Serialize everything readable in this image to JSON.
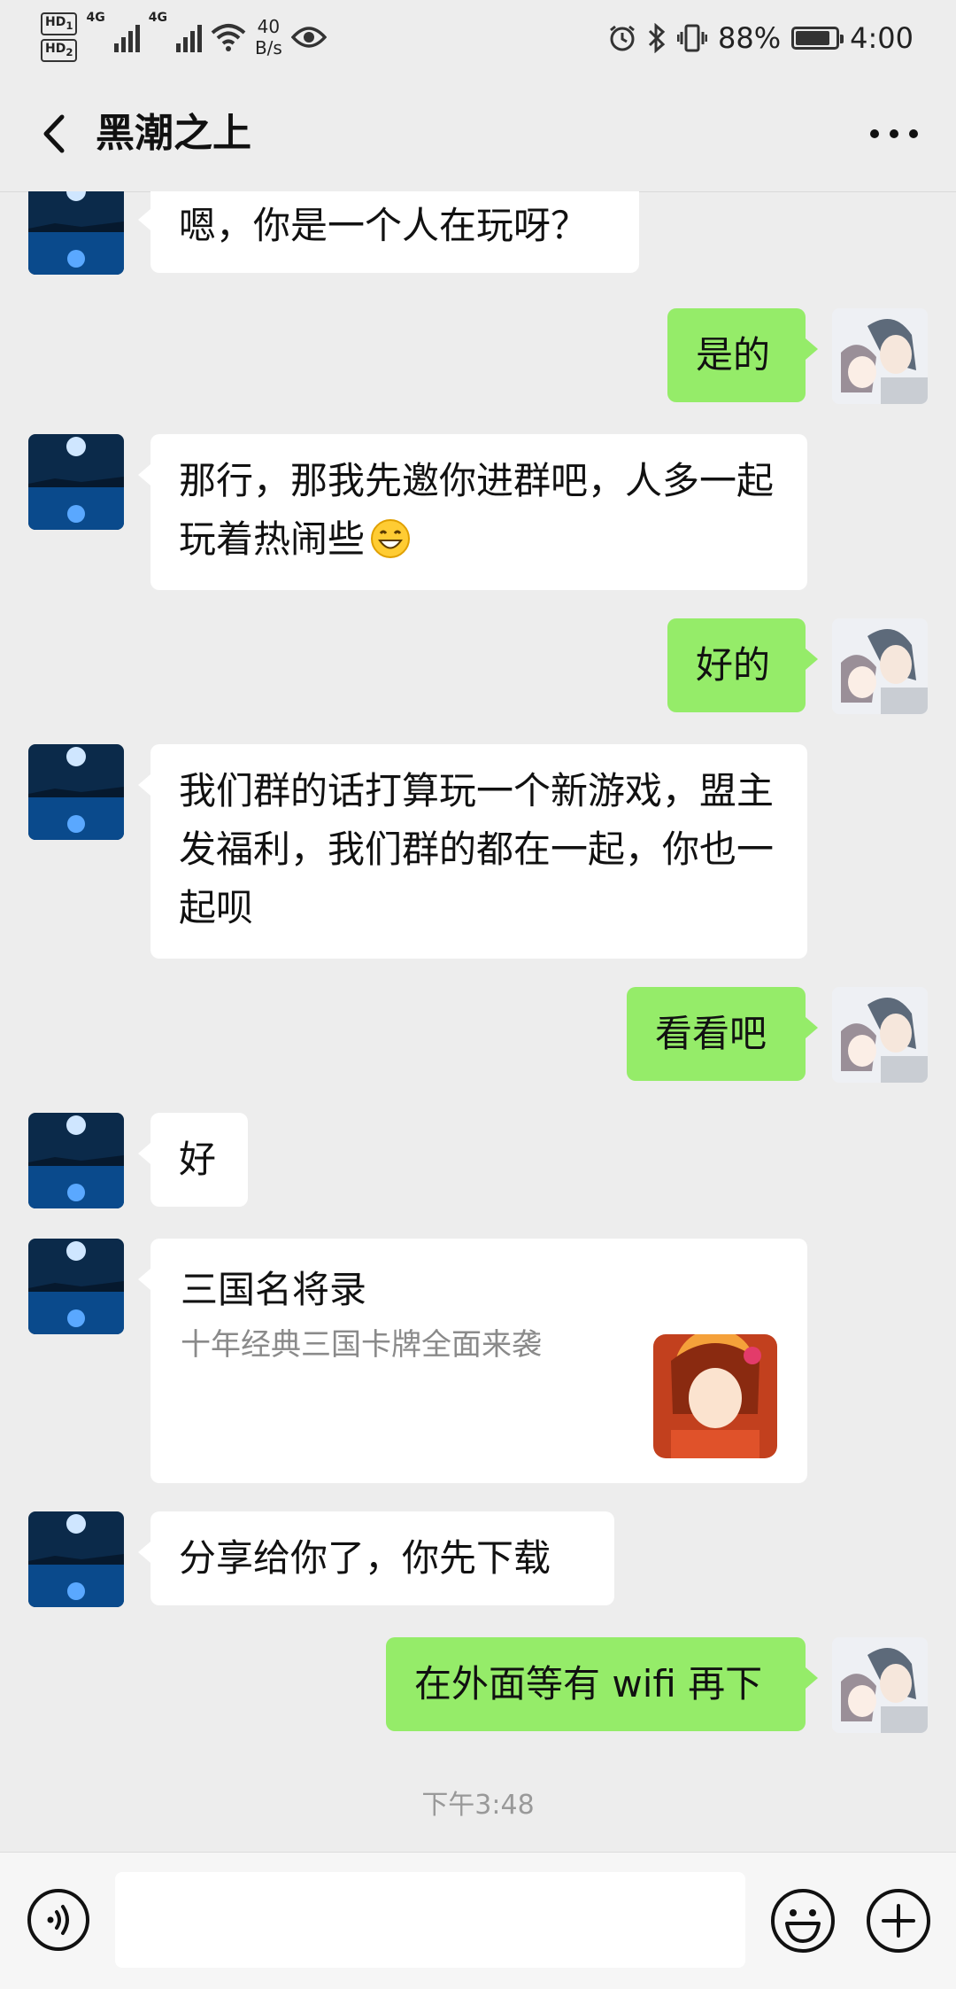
{
  "status_bar": {
    "hd1": "HD",
    "hd1_sub": "1",
    "hd2": "HD",
    "hd2_sub": "2",
    "net1": "4G",
    "net2": "4G",
    "speed_value": "40",
    "speed_unit": "B/s",
    "battery_percent": "88%",
    "battery_level": 0.88,
    "time": "4:00",
    "icons": [
      "signal-icon",
      "wifi-icon",
      "eye-icon",
      "alarm-icon",
      "bluetooth-icon",
      "vibrate-icon",
      "battery-icon"
    ]
  },
  "header": {
    "title": "黑潮之上",
    "back_icon": "chevron-left-icon",
    "more_icon": "more-dots-icon"
  },
  "messages": [
    {
      "from": "other",
      "text": "嗯，你是一个人在玩呀？"
    },
    {
      "from": "self",
      "text": "是的"
    },
    {
      "from": "other",
      "text": "那行，那我先邀你进群吧，人多一起玩着热闹些",
      "emoji": "grinning-face-emoji"
    },
    {
      "from": "self",
      "text": "好的"
    },
    {
      "from": "other",
      "text": "我们群的话打算玩一个新游戏，盟主发福利，我们群的都在一起，你也一起呗"
    },
    {
      "from": "self",
      "text": "看看吧"
    },
    {
      "from": "other",
      "text": "好"
    },
    {
      "from": "other",
      "type": "card",
      "title": "三国名将录",
      "desc": "十年经典三国卡牌全面来袭"
    },
    {
      "from": "other",
      "text": "分享给你了，你先下载"
    },
    {
      "from": "self",
      "text": "在外面等有 wifi 再下"
    }
  ],
  "timestamp": "下午3:48",
  "input_bar": {
    "placeholder": "",
    "voice_icon": "voice-icon",
    "emoji_icon": "emoji-icon",
    "plus_icon": "plus-icon"
  },
  "colors": {
    "background": "#ededed",
    "self_bubble": "#95ec69",
    "other_bubble": "#ffffff"
  }
}
